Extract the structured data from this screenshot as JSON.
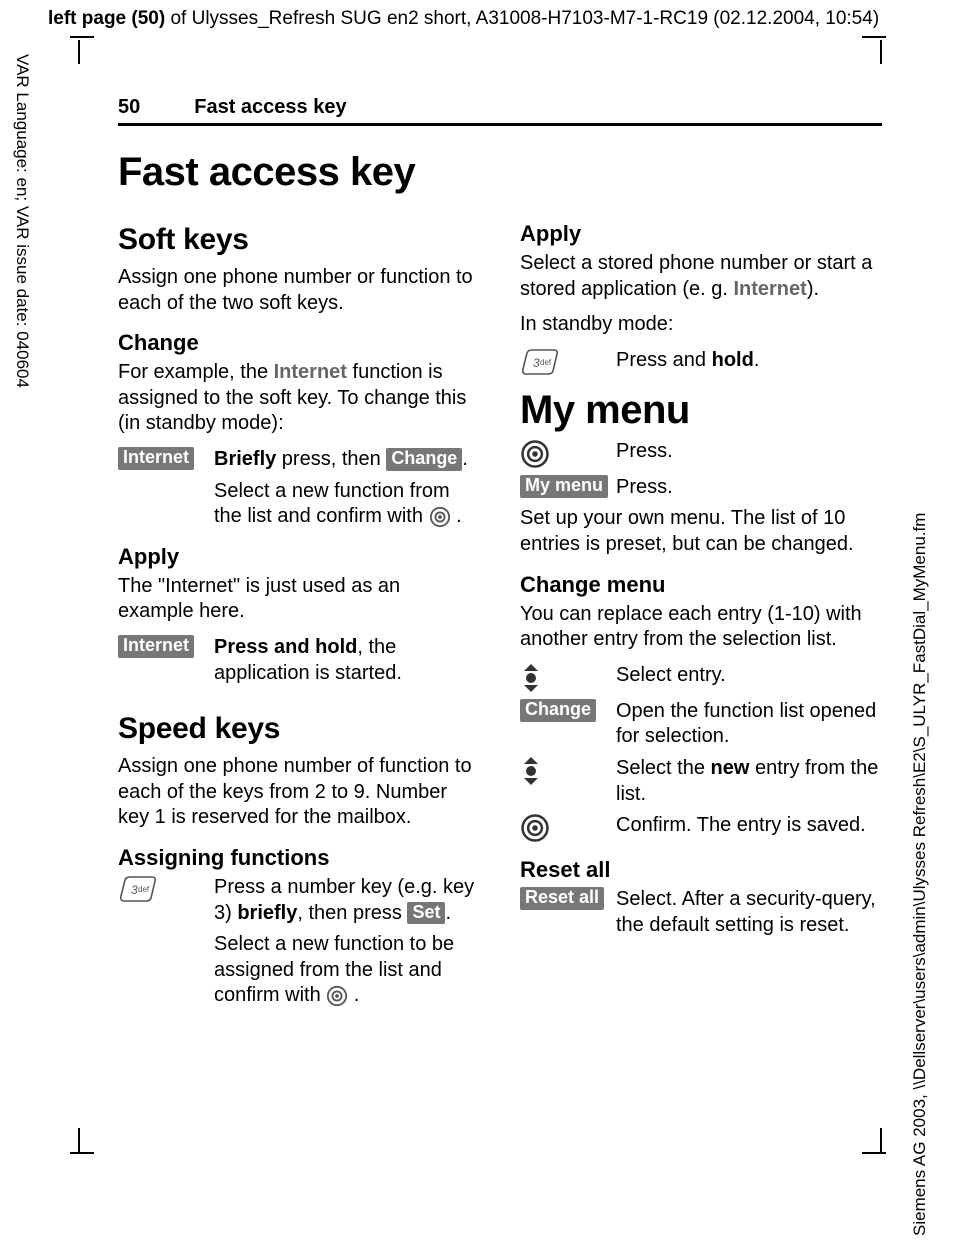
{
  "meta": {
    "top_prefix": "left page (50)",
    "top_rest": " of Ulysses_Refresh SUG en2 short, A31008-H7103-M7-1-RC19 (02.12.2004, 10:54)",
    "left": "VAR Language: en; VAR issue date: 040604",
    "right": "Siemens AG 2003, \\\\Dellserver\\users\\admin\\Ulysses Refresh\\E2\\S_ULYR_FastDial_MyMenu.fm"
  },
  "runhead": {
    "page": "50",
    "title": "Fast access key"
  },
  "title": "Fast access key",
  "left_col": {
    "h2_softkeys": "Soft keys",
    "p_softkeys": "Assign one phone number or function to each of the two soft keys.",
    "h3_change": "Change",
    "p_change": "For example, the ",
    "p_change_term": "Internet",
    "p_change_tail": " function is assigned to the soft key. To change this (in standby mode):",
    "sk_internet": "Internet",
    "row_change_b1": "Briefly",
    "row_change_mid": " press, then ",
    "sk_change": "Change",
    "row_change_tail": ".",
    "row_change2": "Select a new function from the list and confirm with ",
    "h3_apply": "Apply",
    "p_apply": "The \"Internet\" is just used as an example here.",
    "row_apply_b": "Press and hold",
    "row_apply_tail": ", the application is started.",
    "h2_speed": "Speed keys",
    "p_speed": "Assign one phone number of function to each of the keys from 2 to 9. Number key 1 is reserved for the mailbox.",
    "h3_assign": "Assigning functions",
    "row_assign1_a": "Press a number key (e.g. key 3) ",
    "row_assign1_b": "briefly",
    "row_assign1_c": ", then press ",
    "sk_set": "Set",
    "row_assign1_d": ".",
    "row_assign2": "Select a new function to be assigned from the list and confirm with "
  },
  "right_col": {
    "h3_apply": "Apply",
    "p_apply1_a": "Select a stored phone number or start a stored application (e. g. ",
    "p_apply1_term": "Internet",
    "p_apply1_b": ").",
    "p_apply2": "In standby mode:",
    "row_apply_a": "Press and ",
    "row_apply_b": "hold",
    "row_apply_c": ".",
    "h1_mymenu": "My menu",
    "row_press": "Press.",
    "sk_mymenu": "My menu",
    "row_press2": "Press.",
    "p_mymenu": "Set up your own menu. The list of 10 entries is preset, but can be changed.",
    "h3_changemenu": "Change menu",
    "p_changemenu": "You can replace each entry (1-10) with another entry from the selection list.",
    "row_sel": "Select entry.",
    "sk_change": "Change",
    "row_open": "Open the function list opened for selection.",
    "row_new_a": "Select the ",
    "row_new_b": "new",
    "row_new_c": " entry from the list.",
    "row_conf": "Confirm. The entry is saved.",
    "h3_reset": "Reset all",
    "sk_reset": "Reset all",
    "row_reset": "Select. After a security-query, the default setting is reset."
  },
  "icons": {
    "center": "center-select-icon",
    "nav": "nav-up-down-icon",
    "key3": "number-key-3-icon"
  }
}
